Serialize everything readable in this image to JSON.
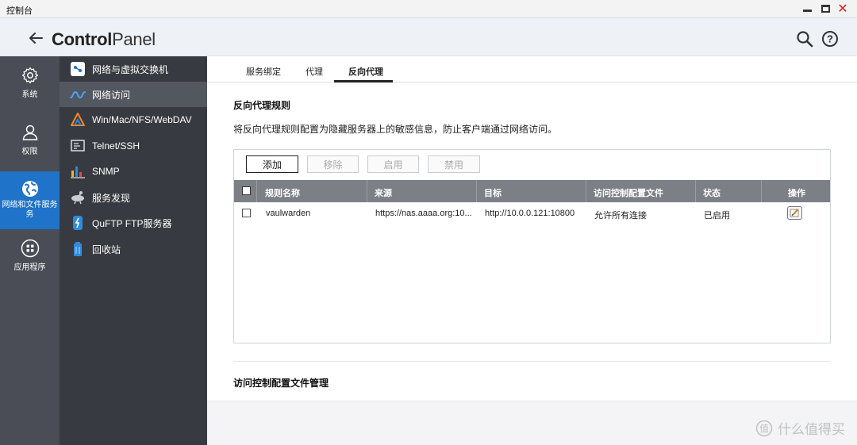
{
  "window": {
    "title": "控制台"
  },
  "header": {
    "app_bold": "Control",
    "app_light": "Panel"
  },
  "rail": [
    {
      "label": "系统",
      "icon": "gear-icon"
    },
    {
      "label": "权限",
      "icon": "user-icon"
    },
    {
      "label": "网络和文件服务",
      "label2": "务",
      "icon": "globe-icon",
      "active": true
    },
    {
      "label": "应用程序",
      "icon": "apps-icon"
    }
  ],
  "submenu": [
    {
      "label": "网络与虚拟交换机",
      "icon": "network-switch-icon"
    },
    {
      "label": "网络访问",
      "icon": "network-access-icon",
      "active": true
    },
    {
      "label": "Win/Mac/NFS/WebDAV",
      "icon": "file-protocol-icon"
    },
    {
      "label": "Telnet/SSH",
      "icon": "terminal-icon"
    },
    {
      "label": "SNMP",
      "icon": "snmp-icon"
    },
    {
      "label": "服务发现",
      "icon": "service-discovery-icon"
    },
    {
      "label": "QuFTP FTP服务器",
      "icon": "ftp-icon"
    },
    {
      "label": "回收站",
      "icon": "recycle-bin-icon"
    }
  ],
  "tabs": [
    {
      "label": "服务绑定"
    },
    {
      "label": "代理"
    },
    {
      "label": "反向代理",
      "active": true
    }
  ],
  "section1": {
    "title": "反向代理规则",
    "desc": "将反向代理规则配置为隐藏服务器上的敏感信息，防止客户端通过网络访问。"
  },
  "toolbar": {
    "add": "添加",
    "remove": "移除",
    "enable": "启用",
    "disable": "禁用"
  },
  "table": {
    "headers": [
      "规则名称",
      "来源",
      "目标",
      "访问控制配置文件",
      "状态",
      "操作"
    ],
    "rows": [
      {
        "name": "vaulwarden",
        "source": "https://nas.aaaa.org:10...",
        "target": "http://10.0.0.121:10800",
        "acl": "允许所有连接",
        "status": "已启用"
      }
    ]
  },
  "section2": {
    "title": "访问控制配置文件管理"
  },
  "watermark": {
    "text": "什么值得买"
  },
  "colors": {
    "accent": "#1f73c9",
    "rail_bg": "#4a4d55",
    "submenu_bg": "#383a41",
    "table_header": "#7c7f86",
    "close": "#d61f1f"
  }
}
